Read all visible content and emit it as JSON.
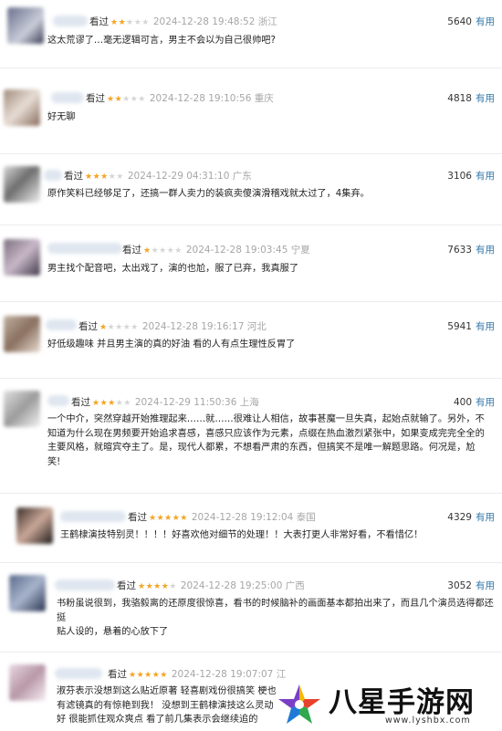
{
  "colors": {
    "star": "#f4a422",
    "useful": "#3377aa",
    "time": "#a6a6a6"
  },
  "reviews": [
    {
      "seen": "看过",
      "stars": "★★",
      "stars_off": "★★★",
      "time": "2024-12-28 19:48:52",
      "loc": "浙江",
      "count": "5640",
      "useful": "有用",
      "text": "这太荒谬了…毫无逻辑可言，男主不会以为自己很帅吧?"
    },
    {
      "seen": "看过",
      "stars": "★★",
      "stars_off": "★★★",
      "time": "2024-12-28 19:10:56",
      "loc": "重庆",
      "count": "4818",
      "useful": "有用",
      "text": "好无聊"
    },
    {
      "seen": "看过",
      "stars": "★★★",
      "stars_off": "★★",
      "time": "2024-12-29 04:31:10",
      "loc": "广东",
      "count": "3106",
      "useful": "有用",
      "text": "原作笑料已经够足了，还搞一群人卖力的装疯卖傻演滑稽戏就太过了，4集弃。"
    },
    {
      "seen": "看过",
      "stars": "★",
      "stars_off": "★★★★",
      "time": "2024-12-28 19:03:45",
      "loc": "宁夏",
      "count": "7633",
      "useful": "有用",
      "text": "男主找个配音吧，太出戏了，演的也尬，服了已弃，我真服了"
    },
    {
      "seen": "看过",
      "stars": "★",
      "stars_off": "★★★★",
      "time": "2024-12-28 19:16:17",
      "loc": "河北",
      "count": "5941",
      "useful": "有用",
      "text": "好低级趣味 并且男主演的真的好油 看的人有点生理性反胃了"
    },
    {
      "seen": "看过",
      "stars": "★★★",
      "stars_off": "★★",
      "time": "2024-12-29 11:50:36",
      "loc": "上海",
      "count": "400",
      "useful": "有用",
      "lines": [
        "一个中介，突然穿越开始推理起来……就……很难让人相信，故事甚魔一旦失真，起始点就输了。另外，不",
        "知道为什么现在男频要开始追求喜感，喜感只应该作为元素，点缀在热血激烈紧张中，如果变成完完全全的",
        "主要风格，就暄宾夺主了。是，现代人都累，不想看严肃的东西，但搞笑不是唯一解题思路。何况是，尬",
        "笑!"
      ]
    },
    {
      "seen": "看过",
      "stars": "★★★★★",
      "stars_off": "",
      "time": "2024-12-28 19:12:04",
      "loc": "泰国",
      "count": "4329",
      "useful": "有用",
      "text": "王鹤棣演技特别灵！！！！好喜欢他对细节的处理！！大表打更人非常好看，不看惜亿！"
    },
    {
      "seen": "看过",
      "stars": "★★★★",
      "stars_off": "★",
      "time": "2024-12-28 19:25:00",
      "loc": "广西",
      "count": "3052",
      "useful": "有用",
      "lines": [
        "书粉虽说很到，我骆毅离的还原度很惊喜，看书的时候脑补的画面基本都拍出来了，而且几个演员选得都还挺",
        "贴人设的，悬着的心放下了"
      ]
    },
    {
      "seen": "看过",
      "stars": "★★★★★",
      "stars_off": "",
      "time": "2024-12-28 19:07:07",
      "loc": "江",
      "count": "",
      "useful": "",
      "lines": [
        "淑芬表示没想到这么贴近原著 轻喜剧戏份很搞笑 梗也",
        "有滤镜真的有惊艳到我！ 没想到王鹤棣演技这么灵动",
        "好 很能抓住观众爽点 看了前几集表示会继续追的"
      ]
    }
  ],
  "watermark": {
    "title": "八星手游网",
    "url": "www.lyshbx.com"
  }
}
